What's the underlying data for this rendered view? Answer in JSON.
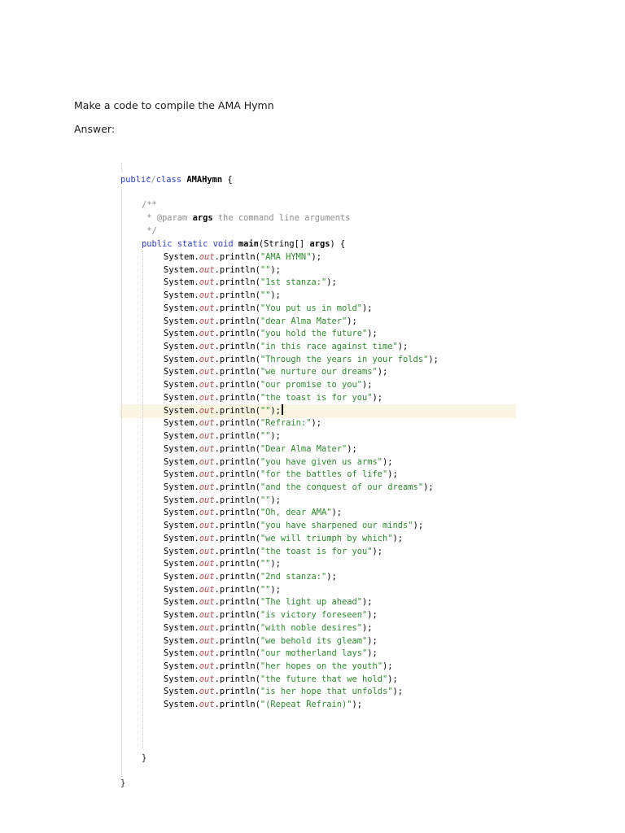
{
  "question": "Make a code to compile the AMA Hymn",
  "answer_label": "Answer:",
  "code": {
    "comment_end": " */",
    "class_kw": "public class ",
    "class_name": "AMAHymn",
    "class_open": " {",
    "javadoc_open": "/**",
    "javadoc_param_prefix": " * @param ",
    "javadoc_param_name": "args",
    "javadoc_param_desc": " the command line arguments",
    "javadoc_close": " */",
    "method_kw": "public static void ",
    "method_name": "main",
    "method_sig": "(String[] ",
    "method_param": "args",
    "method_open": ") {",
    "call_prefix": "System.",
    "call_field": "out",
    "call_method": ".println(",
    "call_suffix": ");",
    "highlighted_line_index": 12,
    "println_lines": [
      "AMA HYMN",
      "",
      "1st stanza:",
      "",
      "You put us in mold",
      "dear Alma Mater",
      "you hold the future",
      "in this race against time",
      "Through the years in your folds",
      "we nurture our dreams",
      "our promise to you",
      "the toast is for you",
      "",
      "Refrain:",
      "",
      "Dear Alma Mater",
      "you have given us arms",
      "for the battles of life",
      "and the conquest of our dreams",
      "",
      "Oh, dear AMA",
      "you have sharpened our minds",
      "we will triumph by which",
      "the toast is for you",
      "",
      "2nd stanza:",
      "",
      "The light up ahead",
      "is victory foreseen",
      "with noble desires",
      "we behold its gleam",
      "our motherland lays",
      "her hopes on the youth",
      "the future that we hold",
      "is her hope that unfolds",
      "(Repeat Refrain)"
    ],
    "method_close": "}",
    "class_close": "}"
  }
}
